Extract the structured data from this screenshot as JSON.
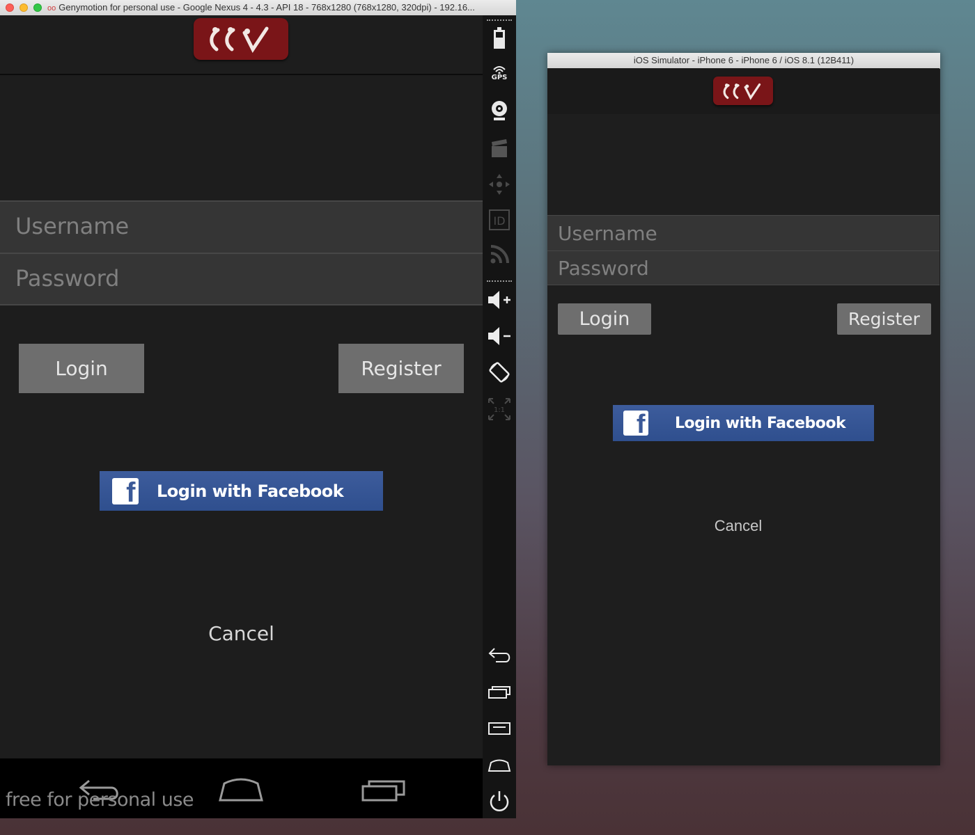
{
  "genymotion": {
    "window_title": "Genymotion for personal use - Google Nexus 4 - 4.3 - API 18 - 768x1280 (768x1280, 320dpi) - 192.16...",
    "title_glyph": "oo",
    "form": {
      "username_placeholder": "Username",
      "password_placeholder": "Password",
      "login_label": "Login",
      "register_label": "Register",
      "facebook_label": "Login with Facebook",
      "facebook_icon_letter": "f",
      "cancel_label": "Cancel"
    },
    "watermark": "free for personal use",
    "toolbar": {
      "gps_label": "GPS",
      "id_label": "ID",
      "pixel_ratio_label": "1:1"
    }
  },
  "ios_simulator": {
    "window_title": "iOS Simulator - iPhone 6 - iPhone 6 / iOS 8.1 (12B411)",
    "form": {
      "username_placeholder": "Username",
      "password_placeholder": "Password",
      "login_label": "Login",
      "register_label": "Register",
      "facebook_label": "Login with Facebook",
      "facebook_icon_letter": "f",
      "cancel_label": "Cancel"
    }
  },
  "colors": {
    "logo_red": "#7a1518",
    "facebook_blue": "#3b5998",
    "button_gray": "#6e6e6e",
    "field_gray": "#353535",
    "app_background": "#1d1d1d"
  }
}
